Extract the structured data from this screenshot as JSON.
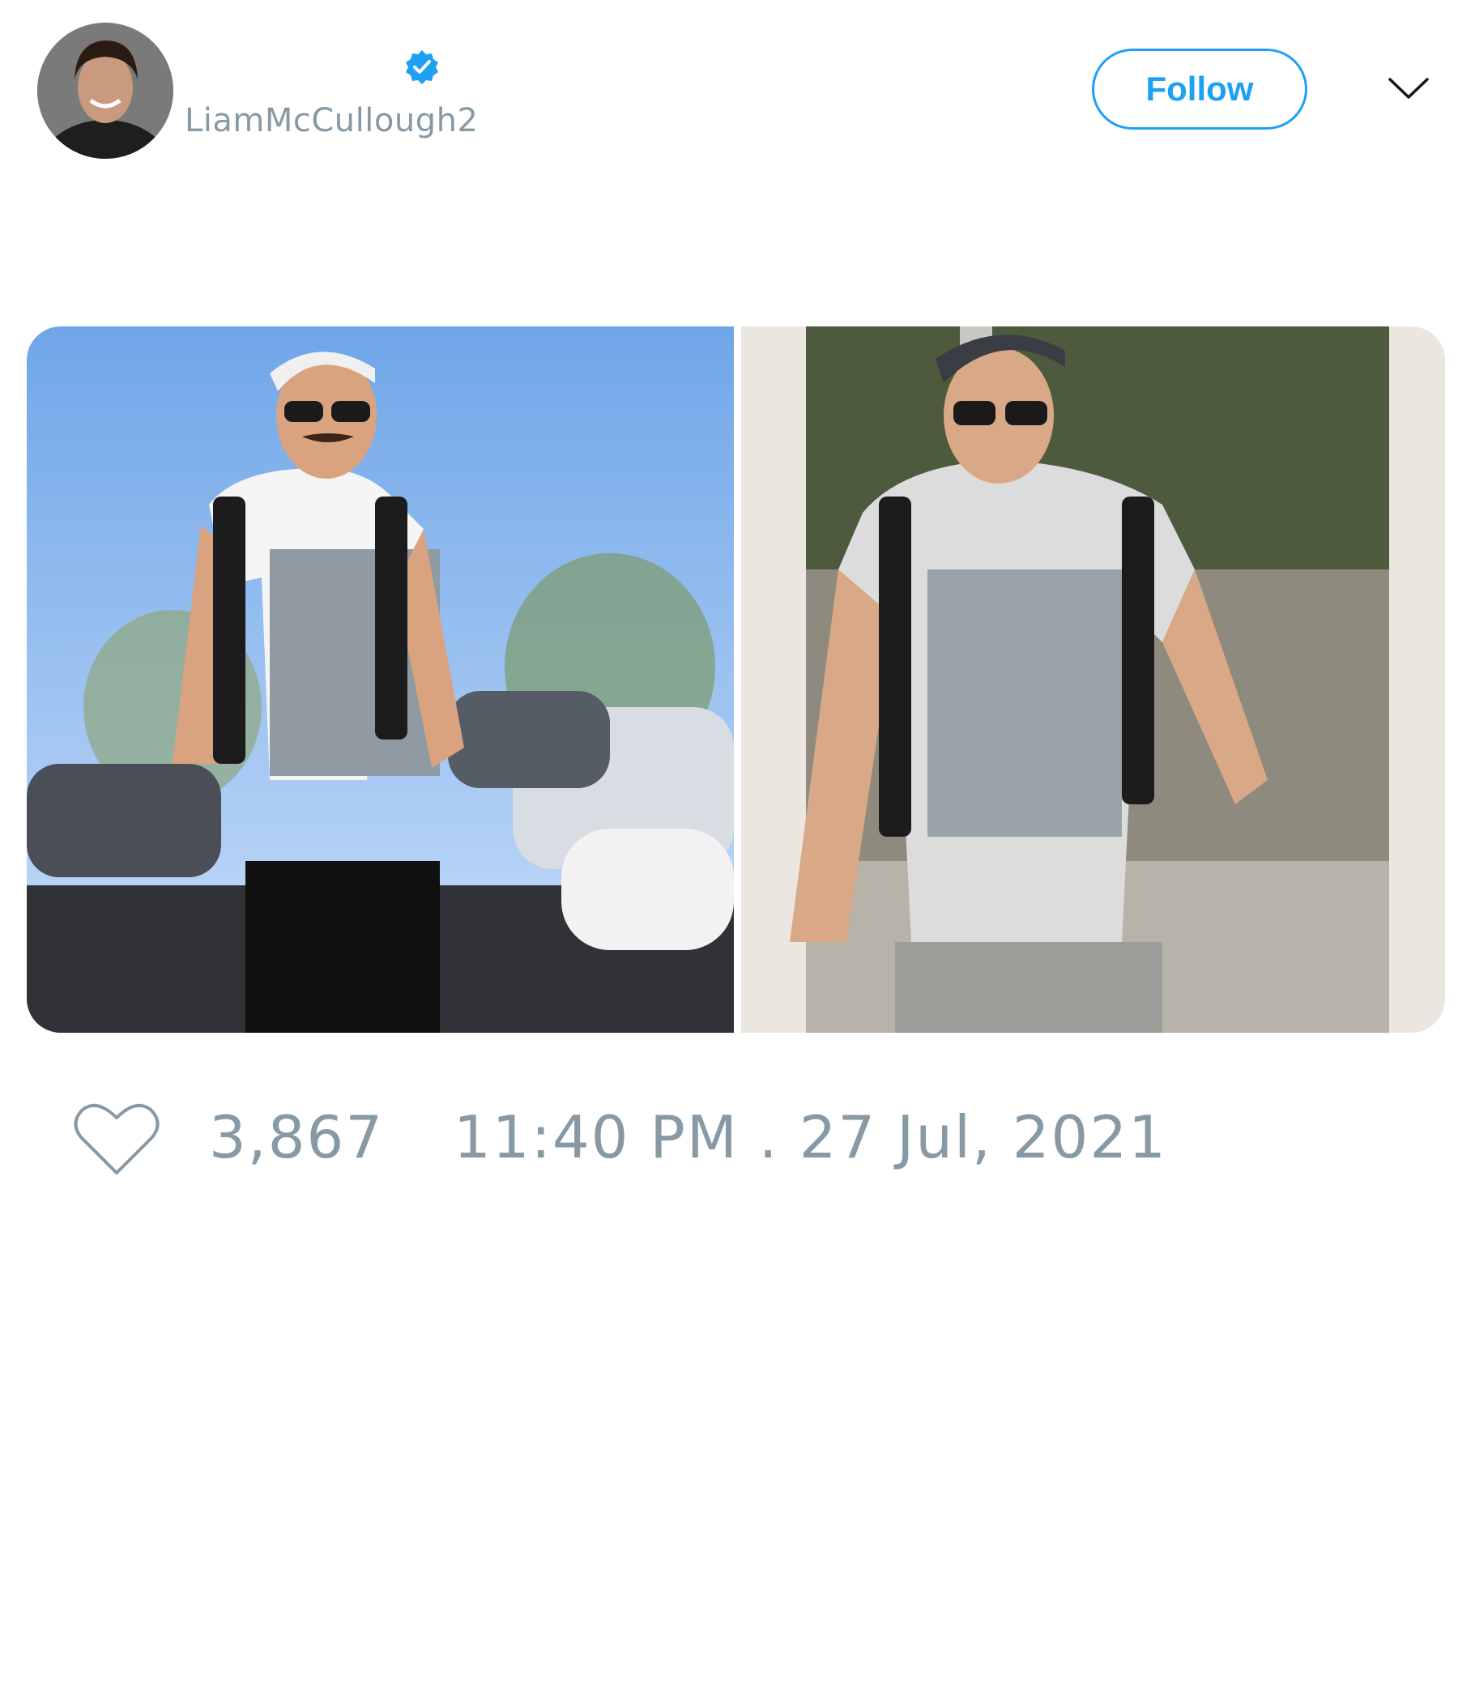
{
  "author": {
    "display_name": "",
    "handle": "LiamMcCullough2",
    "verified": true,
    "avatar_icon": "profile-photo"
  },
  "header": {
    "follow_label": "Follow",
    "menu_icon": "chevron-down-icon"
  },
  "media": {
    "photos": [
      {
        "alt": "photo-man-in-parking-lot"
      },
      {
        "alt": "photo-printed-tshirt"
      }
    ]
  },
  "stats": {
    "likes": "3,867",
    "timestamp": "11:40 PM . 27 Jul, 2021"
  },
  "colors": {
    "accent": "#1da1f2",
    "muted_text": "#8899a6"
  }
}
